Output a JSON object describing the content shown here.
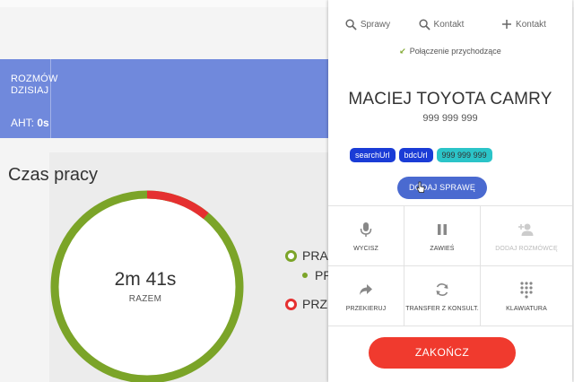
{
  "stats": {
    "title_line1": "ROZMÓW",
    "title_line2": "DZISIAJ",
    "aht_label": "AHT: ",
    "aht_value": "0s"
  },
  "work_time": {
    "title": "Czas pracy",
    "total": "2m 41s",
    "total_label": "RAZEM",
    "ring_fraction_red": 0.11,
    "legend": [
      {
        "label": "PRAC",
        "color": "#7ba428"
      },
      {
        "label": "PR",
        "color": "#7ba428"
      },
      {
        "label": "PRZI",
        "color": "#e53030"
      }
    ]
  },
  "phone": {
    "tabs": [
      {
        "icon": "search-icon",
        "label": "Sprawy"
      },
      {
        "icon": "search-icon",
        "label": "Kontakt"
      },
      {
        "icon": "plus-icon",
        "label": "Kontakt"
      }
    ],
    "incoming_label": "Połączenie przychodzące",
    "caller_name": "MACIEJ TOYOTA CAMRY",
    "caller_number": "999 999 999",
    "tags": [
      "searchUrl",
      "bdcUrl",
      "999 999 999"
    ],
    "add_case_label": "DODAJ SPRAWĘ",
    "actions": [
      {
        "icon": "microphone-icon",
        "label": "WYCISZ",
        "enabled": true
      },
      {
        "icon": "pause-icon",
        "label": "ZAWIEŚ",
        "enabled": true
      },
      {
        "icon": "add-person-icon",
        "label": "DODAJ ROZMÓWCĘ",
        "enabled": false
      },
      {
        "icon": "forward-icon",
        "label": "PRZEKIERUJ",
        "enabled": true
      },
      {
        "icon": "transfer-icon",
        "label": "TRANSFER Z KONSULT.",
        "enabled": true
      },
      {
        "icon": "keypad-icon",
        "label": "KLAWIATURA",
        "enabled": true
      }
    ],
    "end_call_label": "ZAKOŃCZ"
  },
  "colors": {
    "accent_blue": "#7089dc",
    "green": "#7ba428",
    "red": "#e53030",
    "end_call": "#f03a2e"
  }
}
